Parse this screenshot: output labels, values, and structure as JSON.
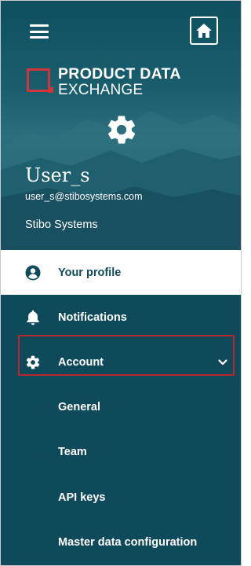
{
  "header": {
    "menu_icon": "hamburger-menu-icon",
    "home_icon": "home-icon",
    "logo": {
      "line1": "PRODUCT DATA",
      "line2": "EXCHANGE",
      "accent_color": "#d1343b"
    },
    "avatar_icon": "gear-icon",
    "user": {
      "name": "User_s",
      "email": "user_s@stibosystems.com",
      "company": "Stibo Systems"
    }
  },
  "menu": {
    "items": [
      {
        "label": "Your profile",
        "icon": "user-circle-icon",
        "active": true
      },
      {
        "label": "Notifications",
        "icon": "bell-icon"
      },
      {
        "label": "Account",
        "icon": "gear-icon",
        "expanded": true,
        "highlight_color": "#b8242f"
      }
    ],
    "account_subitems": [
      {
        "label": "General"
      },
      {
        "label": "Team"
      },
      {
        "label": "API keys"
      },
      {
        "label": "Master data configuration"
      }
    ]
  },
  "colors": {
    "primary": "#0f4a5b",
    "text_on_primary": "#ffffff"
  }
}
